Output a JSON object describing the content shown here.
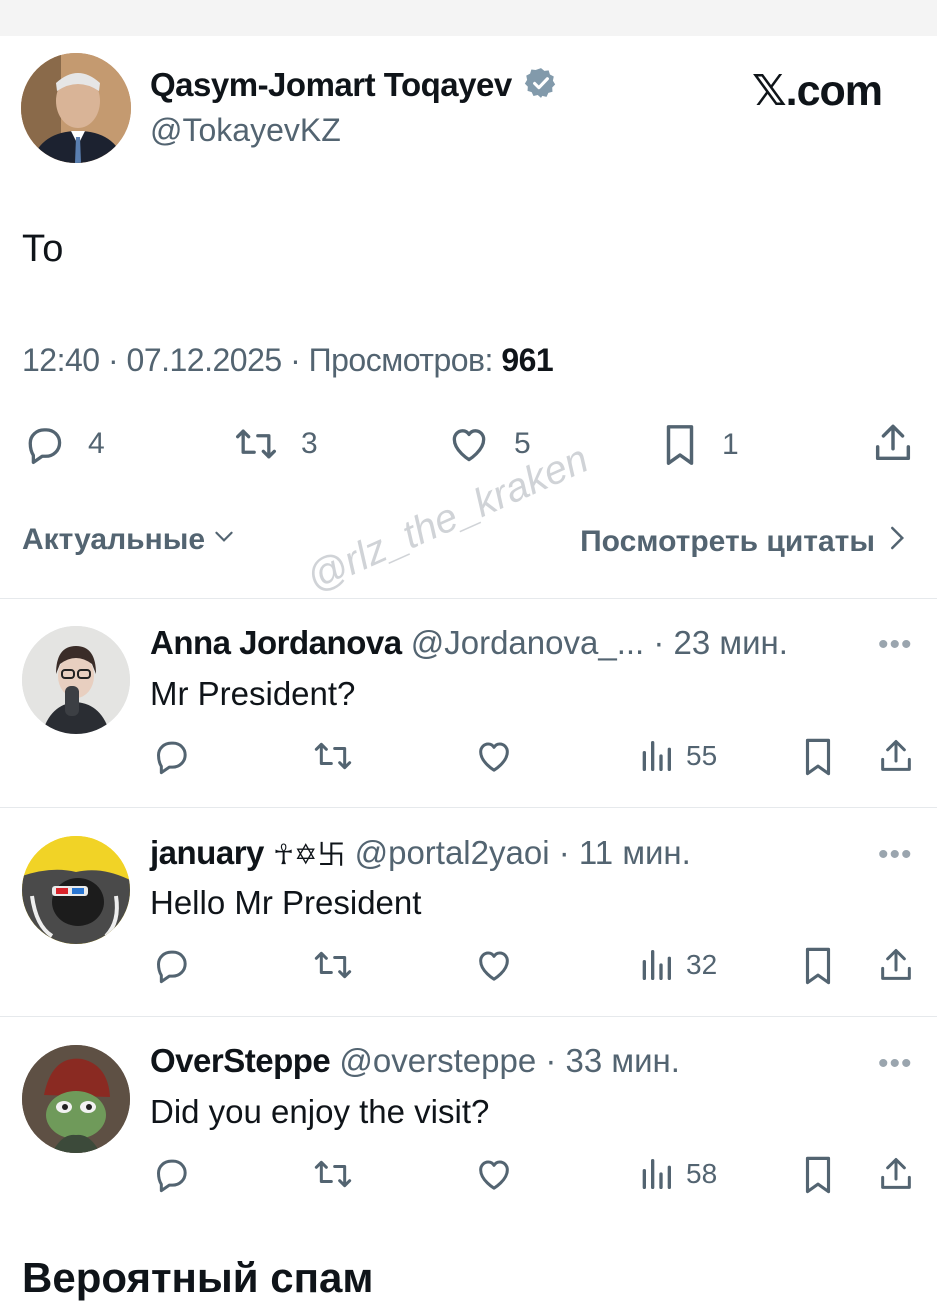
{
  "post": {
    "author_name": "Qasym-Jomart Toqayev",
    "author_handle": "@TokayevKZ",
    "site": "𝕏.com",
    "text": "То",
    "time": "12:40",
    "date": "07.12.2025",
    "views_label": "Просмотров:",
    "views_count": "961",
    "stats": {
      "replies": "4",
      "reposts": "3",
      "likes": "5",
      "bookmarks": "1"
    }
  },
  "sort": {
    "label": "Актуальные",
    "quotes_label": "Посмотреть цитаты"
  },
  "watermark": "@rlz_the_kraken",
  "replies": [
    {
      "name": "Anna Jordanova",
      "handle": "@Jordanova_...",
      "time": "23 мин.",
      "text": "Mr President?",
      "views": "55"
    },
    {
      "name": "january",
      "name_symbols": "☥✡卐",
      "handle": "@portal2yaoi",
      "time": "11 мин.",
      "text": "Hello Mr President",
      "views": "32"
    },
    {
      "name": "OverSteppe",
      "handle": "@oversteppe",
      "time": "33 мин.",
      "text": "Did you enjoy the visit?",
      "views": "58"
    }
  ],
  "section_title": "Вероятный спам",
  "icons": {
    "verified": "verified-badge-icon",
    "reply": "reply-icon",
    "repost": "repost-icon",
    "like": "heart-icon",
    "bookmark": "bookmark-icon",
    "share": "share-icon",
    "views": "views-icon",
    "more": "more-icon"
  },
  "colors": {
    "text": "#0f1419",
    "secondary": "#536471",
    "verified": "#829aab"
  }
}
